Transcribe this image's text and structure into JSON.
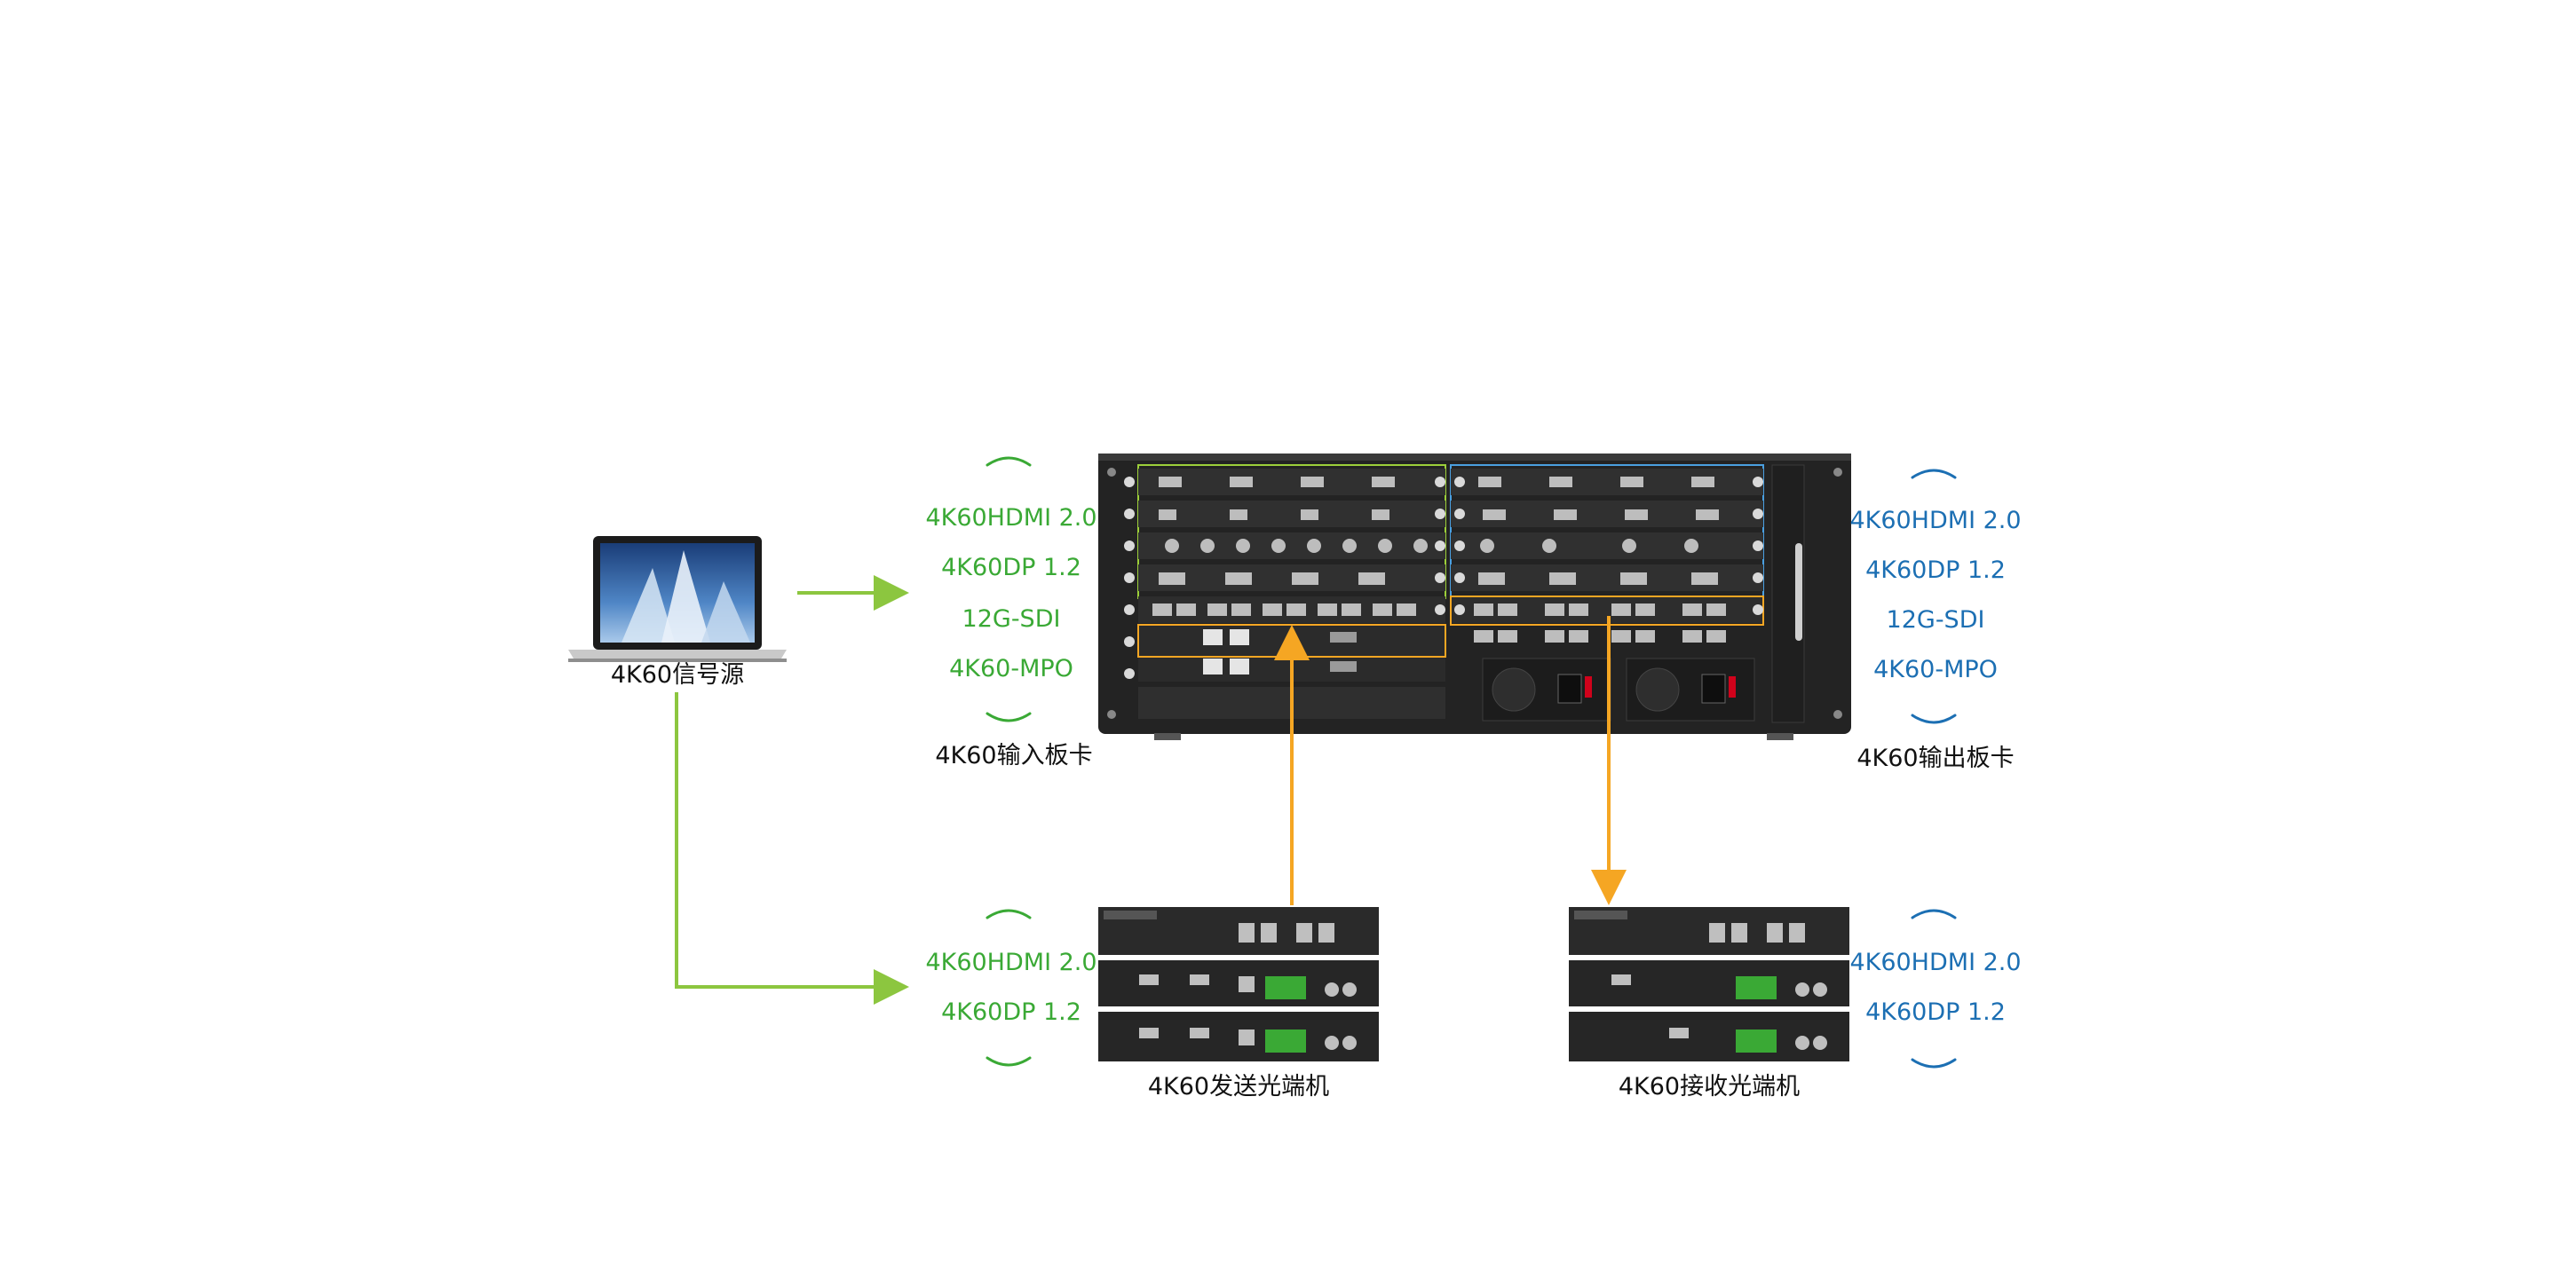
{
  "colors": {
    "input_text": "#3aa935",
    "output_text": "#1c6fb3",
    "arrow_green": "#8cc63f",
    "arrow_orange": "#f5a623",
    "device_body": "#2a2a2a"
  },
  "source": {
    "label": "4K60信号源"
  },
  "input_card": {
    "caption": "4K60输入板卡",
    "formats": [
      "4K60HDMI 2.0",
      "4K60DP 1.2",
      "12G-SDI",
      "4K60-MPO"
    ]
  },
  "output_card": {
    "caption": "4K60输出板卡",
    "formats": [
      "4K60HDMI 2.0",
      "4K60DP 1.2",
      "12G-SDI",
      "4K60-MPO"
    ]
  },
  "transmitter": {
    "caption": "4K60发送光端机",
    "formats": [
      "4K60HDMI 2.0",
      "4K60DP 1.2"
    ]
  },
  "receiver": {
    "caption": "4K60接收光端机",
    "formats": [
      "4K60HDMI 2.0",
      "4K60DP 1.2"
    ]
  },
  "icons": [
    "laptop-icon",
    "arrow-right-icon",
    "arrow-up-icon",
    "arrow-down-icon"
  ]
}
